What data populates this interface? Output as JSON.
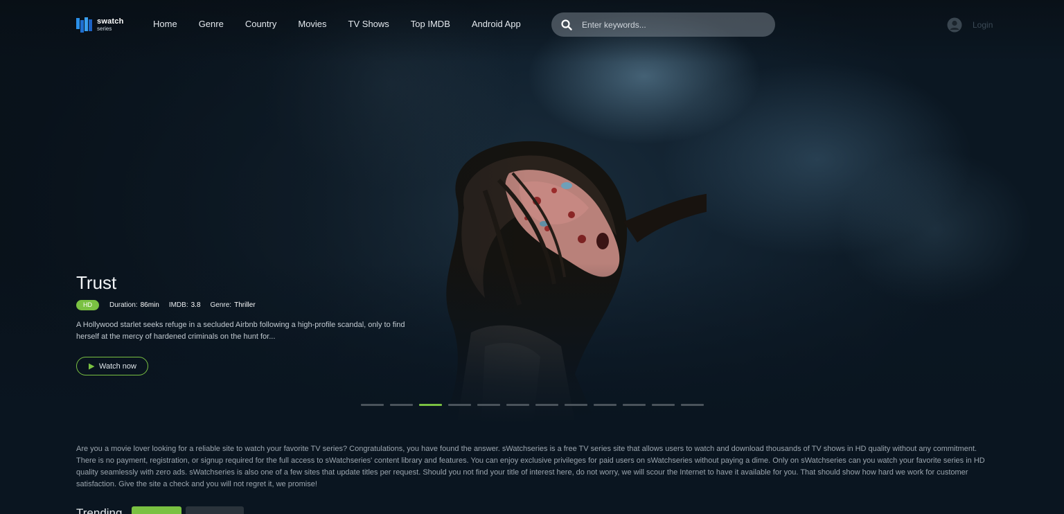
{
  "site": {
    "logo_word": "swatch",
    "logo_sub": "series"
  },
  "nav": {
    "items": [
      {
        "label": "Home"
      },
      {
        "label": "Genre"
      },
      {
        "label": "Country"
      },
      {
        "label": "Movies"
      },
      {
        "label": "TV Shows"
      },
      {
        "label": "Top IMDB"
      },
      {
        "label": "Android App"
      }
    ]
  },
  "search": {
    "placeholder": "Enter keywords...",
    "value": ""
  },
  "user": {
    "login_label": "Login"
  },
  "hero": {
    "title": "Trust",
    "quality": "HD",
    "duration_label": "Duration:",
    "duration": "86min",
    "imdb_label": "IMDB:",
    "imdb": "3.8",
    "genre_label": "Genre:",
    "genre": "Thriller",
    "description": "A Hollywood starlet seeks refuge in a secluded Airbnb following a high-profile scandal, only to find herself at the mercy of hardened criminals on the hunt for...",
    "watch_label": "Watch now",
    "slides_total": 12,
    "active_slide": 3
  },
  "about": {
    "text": "Are you a movie lover looking for a reliable site to watch your favorite TV series? Congratulations, you have found the answer. sWatchseries is a free TV series site that allows users to watch and download thousands of TV shows in HD quality without any commitment. There is no payment, registration, or signup required for the full access to sWatchseries' content library and features. You can enjoy exclusive privileges for paid users on sWatchseries without paying a dime. Only on sWatchseries can you watch your favorite series in HD quality seamlessly with zero ads. sWatchseries is also one of a few sites that update titles per request. Should you not find your title of interest here, do not worry, we will scour the Internet to have it available for you. That should show how hard we work for customer satisfaction. Give the site a check and you will not regret it, we promise!"
  },
  "trending": {
    "title": "Trending"
  },
  "colors": {
    "accent": "#7ac142",
    "background": "#0a1520"
  },
  "icons": {
    "logo": "bars-logo-icon",
    "search": "search-icon",
    "user": "user-circle-icon",
    "play": "play-icon"
  }
}
